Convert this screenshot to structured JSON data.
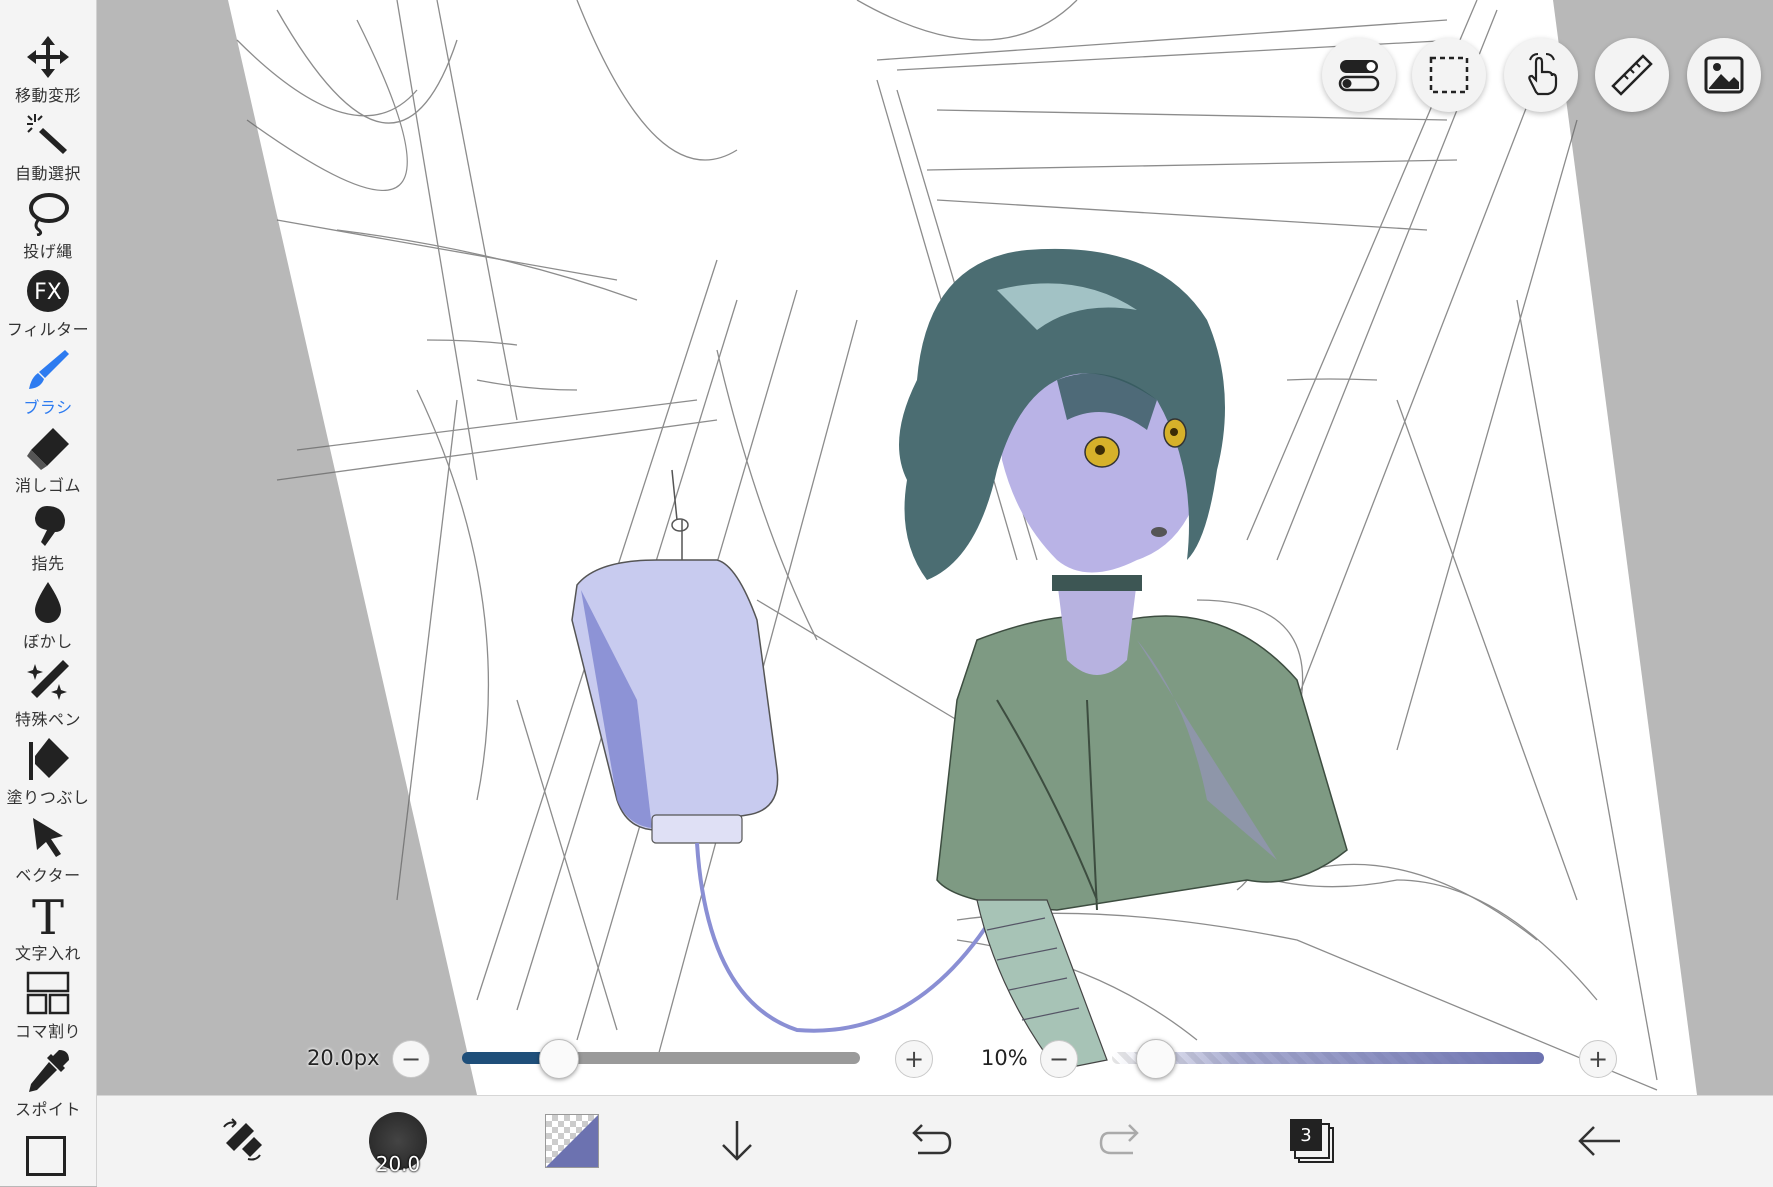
{
  "toolbar": {
    "tools": [
      {
        "id": "move",
        "label": "移動変形",
        "icon": "move-arrows-icon"
      },
      {
        "id": "auto-select",
        "label": "自動選択",
        "icon": "magic-wand-icon"
      },
      {
        "id": "lasso",
        "label": "投げ縄",
        "icon": "lasso-icon"
      },
      {
        "id": "filter",
        "label": "フィルター",
        "icon": "fx-icon",
        "icon_text": "FX"
      },
      {
        "id": "brush",
        "label": "ブラシ",
        "icon": "brush-icon",
        "active": true
      },
      {
        "id": "eraser",
        "label": "消しゴム",
        "icon": "eraser-icon"
      },
      {
        "id": "finger",
        "label": "指先",
        "icon": "finger-icon"
      },
      {
        "id": "blur",
        "label": "ぼかし",
        "icon": "drop-icon"
      },
      {
        "id": "special-pen",
        "label": "特殊ペン",
        "icon": "sparkle-pen-icon"
      },
      {
        "id": "fill",
        "label": "塗りつぶし",
        "icon": "fill-bucket-icon"
      },
      {
        "id": "vector",
        "label": "ベクター",
        "icon": "cursor-arrow-icon"
      },
      {
        "id": "text",
        "label": "文字入れ",
        "icon": "text-t-icon",
        "icon_text": "T"
      },
      {
        "id": "frame",
        "label": "コマ割り",
        "icon": "panel-divide-icon"
      },
      {
        "id": "eyedropper",
        "label": "スポイト",
        "icon": "eyedropper-icon"
      }
    ],
    "active_color": "#2d7bf0"
  },
  "top_buttons": [
    "toggle-icon",
    "selection-rect-icon",
    "hand-touch-icon",
    "ruler-icon",
    "image-icon"
  ],
  "brush_size": {
    "label": "20.0px",
    "minus": "−",
    "plus": "+",
    "value_fraction": 0.24,
    "fill_color": "#1f4f7a"
  },
  "opacity": {
    "label": "10%",
    "minus": "−",
    "plus": "+",
    "value_fraction": 0.1,
    "fill_color": "#6c72b0"
  },
  "bottom": {
    "brush_preview_label": "20.0",
    "layer_count": "3",
    "current_color": "#6c72b0"
  }
}
